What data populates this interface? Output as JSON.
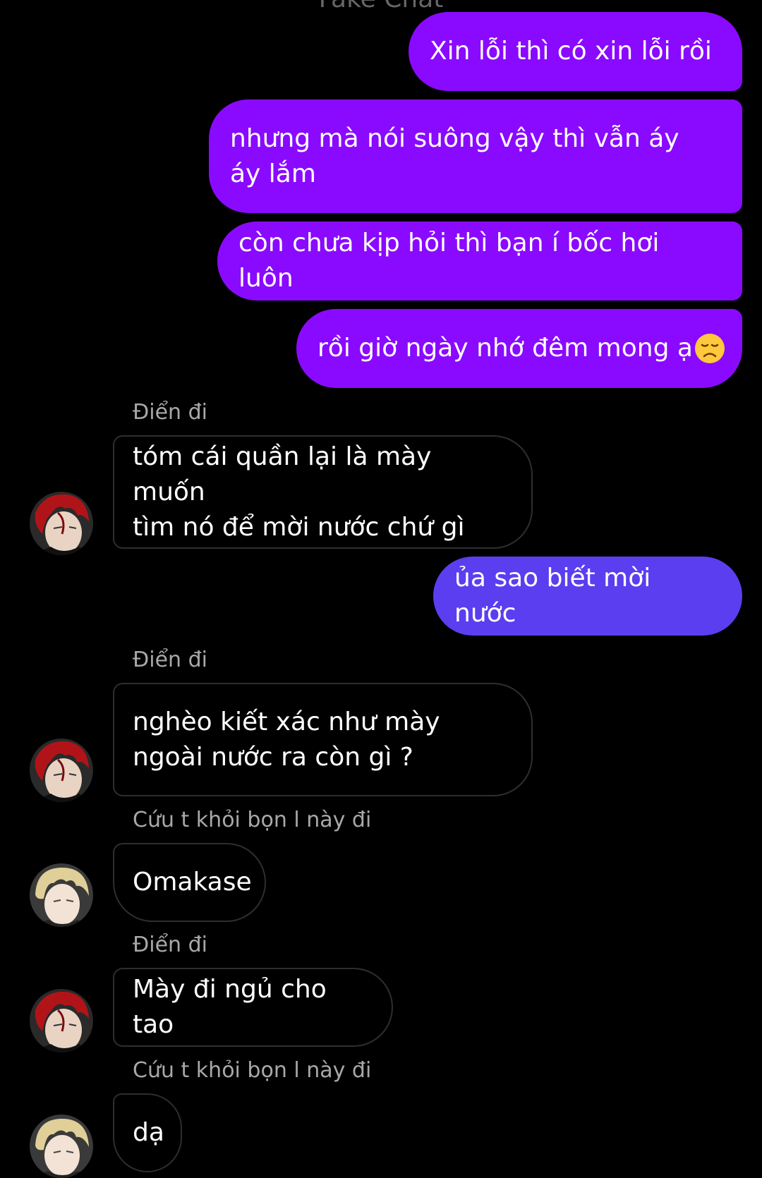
{
  "header": {
    "title_partial": "Fake Chat"
  },
  "colors": {
    "outgoing": "#8a0aff",
    "outgoing_alt": "#5b3ef0",
    "incoming_border": "#2e2e2e",
    "background": "#000000"
  },
  "messages": [
    {
      "side": "out",
      "text": "Xin lỗi thì có xin lỗi rồi"
    },
    {
      "side": "out",
      "text": "nhưng mà nói suông vậy thì vẫn áy\náy lắm"
    },
    {
      "side": "out",
      "text": "còn chưa kịp hỏi thì bạn í bốc hơi luôn"
    },
    {
      "side": "out",
      "text": "rồi giờ ngày nhớ đêm mong ạ",
      "emoji": "disappointed-face"
    },
    {
      "side": "in",
      "sender": "Điển đi",
      "text": "tóm cái quần lại là mày muốn\ntìm nó để mời nước chứ gì",
      "avatar": "red-hair-avatar"
    },
    {
      "side": "out",
      "text": "ủa sao biết mời nước"
    },
    {
      "side": "in",
      "sender": "Điển đi",
      "text": "nghèo kiết xác như mày\nngoài nước ra còn gì ?",
      "avatar": "red-hair-avatar"
    },
    {
      "side": "in",
      "sender": "Cứu t khỏi bọn l này đi",
      "text": "Omakase",
      "avatar": "blonde-hair-avatar"
    },
    {
      "side": "in",
      "sender": "Điển đi",
      "text": "Mày đi ngủ cho tao",
      "avatar": "red-hair-avatar"
    },
    {
      "side": "in",
      "sender": "Cứu t khỏi bọn l này đi",
      "text": "dạ",
      "avatar": "blonde-hair-avatar"
    }
  ]
}
